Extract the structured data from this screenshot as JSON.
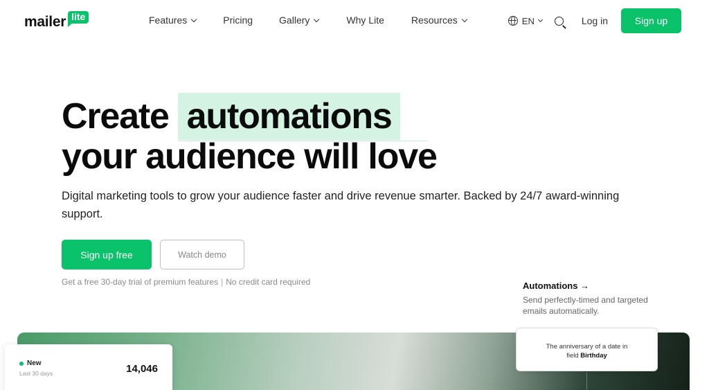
{
  "nav": {
    "logo_text": "mailer",
    "logo_badge": "lite",
    "menu": [
      {
        "label": "Features",
        "dropdown": true
      },
      {
        "label": "Pricing",
        "dropdown": false
      },
      {
        "label": "Gallery",
        "dropdown": true
      },
      {
        "label": "Why Lite",
        "dropdown": false
      },
      {
        "label": "Resources",
        "dropdown": true
      }
    ],
    "language": "EN",
    "login": "Log in",
    "signup": "Sign up"
  },
  "hero": {
    "title_prefix": "Create",
    "title_highlight": "automations",
    "title_line2": "your audience will love",
    "lead": "Digital marketing tools to grow your audience faster and drive revenue smarter. Backed by 24/7 award-winning support.",
    "primary_cta": "Sign up free",
    "secondary_cta": "Watch demo",
    "trial_note_a": "Get a free 30-day trial of premium features",
    "trial_note_b": "No credit card required"
  },
  "promo": {
    "title": "Automations →",
    "description": "Send perfectly-timed and targeted emails automatically."
  },
  "stat_card": {
    "label": "New",
    "sublabel": "Last 30 days",
    "value": "14,046"
  },
  "trigger_card": {
    "text_line1": "The anniversary of a date in",
    "text_prefix": "field",
    "field_name": "Birthday"
  },
  "colors": {
    "accent": "#09c269",
    "highlight_bg": "#d4f3e3"
  }
}
